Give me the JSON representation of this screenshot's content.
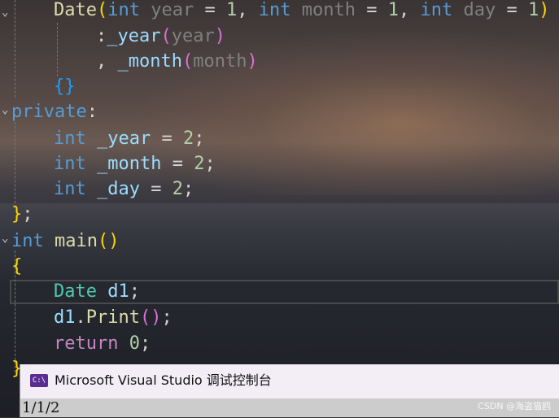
{
  "code": {
    "line1": {
      "fn": "Date",
      "p1_type": "int",
      "p1_name": "year",
      "p1_val": "1",
      "p2_type": "int",
      "p2_name": "month",
      "p2_val": "1",
      "p3_type": "int",
      "p3_name": "day",
      "p3_val": "1"
    },
    "line2": {
      "member": "_year",
      "arg": "year"
    },
    "line3": {
      "member": "_month",
      "arg": "month"
    },
    "line5": {
      "keyword": "private"
    },
    "line6": {
      "type": "int",
      "name": "_year",
      "val": "2"
    },
    "line7": {
      "type": "int",
      "name": "_month",
      "val": "2"
    },
    "line8": {
      "type": "int",
      "name": "_day",
      "val": "2"
    },
    "line10": {
      "type": "int",
      "fn": "main"
    },
    "line12": {
      "type": "Date",
      "var": "d1"
    },
    "line13": {
      "obj": "d1",
      "method": "Print"
    },
    "line14": {
      "keyword": "return",
      "val": "0"
    }
  },
  "console": {
    "title": "Microsoft Visual Studio 调试控制台",
    "icon_text": "C:\\",
    "output": "1/1/2"
  },
  "watermark": "CSDN @海盗猫鸥",
  "colors": {
    "keyword": "#569cd6",
    "control": "#c586c0",
    "function": "#dcdcaa",
    "type": "#4ec9b0",
    "number": "#b5cea8",
    "variable": "#9cdcfe"
  }
}
